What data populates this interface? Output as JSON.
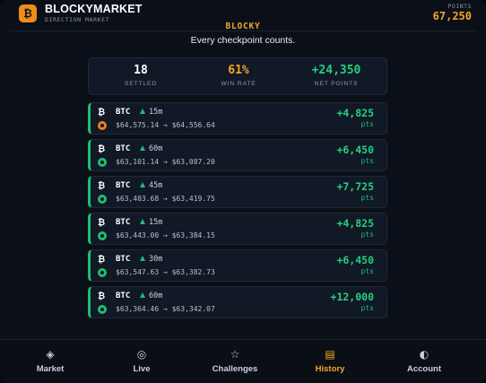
{
  "app": {
    "brand": "BLOCKYMARKET",
    "subtitle": "DIRECTION MARKET",
    "logo_glyph": "₿",
    "points_label": "POINTS",
    "points_value": "67,250"
  },
  "hero": {
    "player": "BLOCKY",
    "tagline": "Every checkpoint counts."
  },
  "stats": [
    {
      "value": "18",
      "label": "SETTLED",
      "color": "#ffffff"
    },
    {
      "value": "61%",
      "label": "WIN RATE",
      "color": "#f5a623"
    },
    {
      "value": "+24,350",
      "label": "NET POINTS",
      "color": "#22d17f"
    }
  ],
  "history": [
    {
      "asset": "BTC",
      "direction": "up",
      "interval": "15m",
      "prices": "$64,575.14 → $64,556.64",
      "points": "+4,825",
      "unit": "pts",
      "sub_icon": "orange"
    },
    {
      "asset": "BTC",
      "direction": "up",
      "interval": "60m",
      "prices": "$63,101.14 → $63,087.20",
      "points": "+6,450",
      "unit": "pts",
      "sub_icon": "green"
    },
    {
      "asset": "BTC",
      "direction": "up",
      "interval": "45m",
      "prices": "$63,403.68 → $63,419.75",
      "points": "+7,725",
      "unit": "pts",
      "sub_icon": "green"
    },
    {
      "asset": "BTC",
      "direction": "up",
      "interval": "15m",
      "prices": "$63,443.00 → $63,384.15",
      "points": "+4,825",
      "unit": "pts",
      "sub_icon": "green"
    },
    {
      "asset": "BTC",
      "direction": "up",
      "interval": "30m",
      "prices": "$63,547.63 → $63,382.73",
      "points": "+6,450",
      "unit": "pts",
      "sub_icon": "green"
    },
    {
      "asset": "BTC",
      "direction": "up",
      "interval": "60m",
      "prices": "$63,364.46 → $63,342.07",
      "points": "+12,000",
      "unit": "pts",
      "sub_icon": "green"
    }
  ],
  "nav": [
    {
      "label": "Market",
      "icon": "market-diamond-icon",
      "glyph": "◈",
      "active": false
    },
    {
      "label": "Live",
      "icon": "live-broadcast-icon",
      "glyph": "◎",
      "active": false
    },
    {
      "label": "Challenges",
      "icon": "star-icon",
      "glyph": "☆",
      "active": false
    },
    {
      "label": "History",
      "icon": "history-receipt-icon",
      "glyph": "▤",
      "active": true
    },
    {
      "label": "Account",
      "icon": "account-half-circle-icon",
      "glyph": "◐",
      "active": false
    }
  ],
  "colors": {
    "accent": "#f5a623",
    "positive": "#22d17f",
    "background": "#0b1018",
    "card": "#111826"
  }
}
